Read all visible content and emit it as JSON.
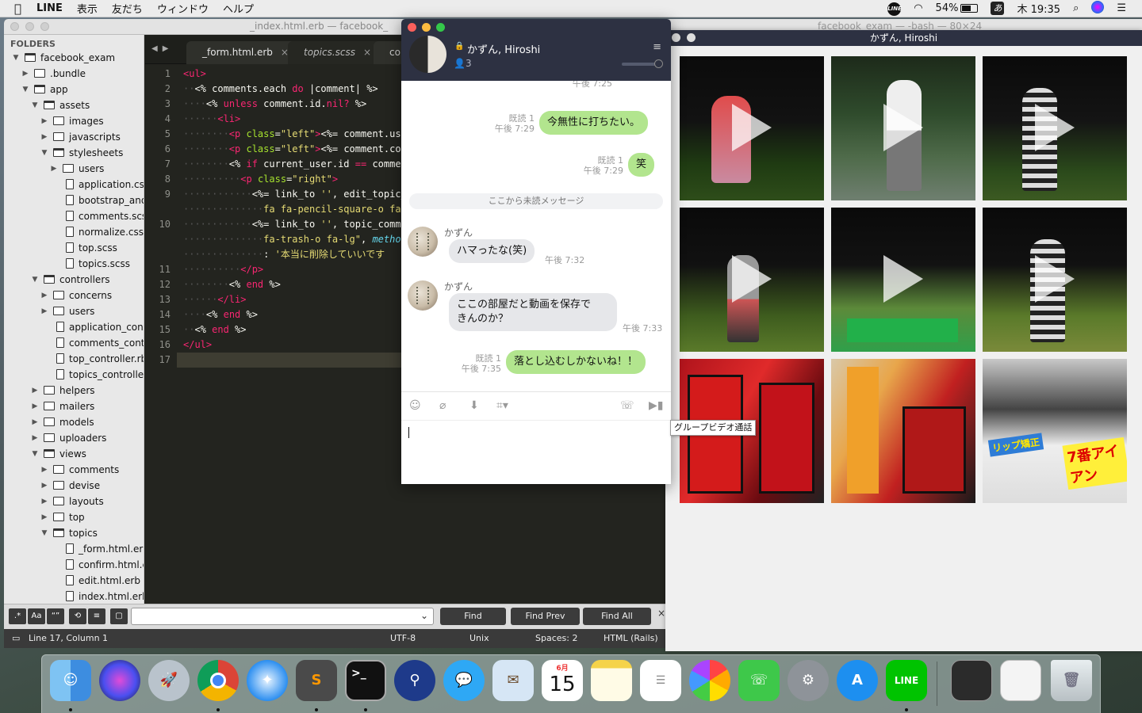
{
  "menubar": {
    "app": "LINE",
    "items": [
      "表示",
      "友だち",
      "ウィンドウ",
      "ヘルプ"
    ],
    "line_badge": "LINE",
    "battery": "54%",
    "ime": "あ",
    "clock": "木 19:35"
  },
  "sublime": {
    "title": "_index.html.erb — facebook_",
    "folders_header": "FOLDERS",
    "tree": [
      {
        "label": "facebook_exam",
        "depth": 0,
        "type": "folder",
        "open": true
      },
      {
        "label": ".bundle",
        "depth": 1,
        "type": "folder",
        "open": false
      },
      {
        "label": "app",
        "depth": 1,
        "type": "folder",
        "open": true
      },
      {
        "label": "assets",
        "depth": 2,
        "type": "folder",
        "open": true
      },
      {
        "label": "images",
        "depth": 3,
        "type": "folder",
        "open": false
      },
      {
        "label": "javascripts",
        "depth": 3,
        "type": "folder",
        "open": false
      },
      {
        "label": "stylesheets",
        "depth": 3,
        "type": "folder",
        "open": true
      },
      {
        "label": "users",
        "depth": 4,
        "type": "folder",
        "open": false
      },
      {
        "label": "application.css",
        "depth": 4,
        "type": "file"
      },
      {
        "label": "bootstrap_and_",
        "depth": 4,
        "type": "file"
      },
      {
        "label": "comments.scss",
        "depth": 4,
        "type": "file"
      },
      {
        "label": "normalize.css",
        "depth": 4,
        "type": "file"
      },
      {
        "label": "top.scss",
        "depth": 4,
        "type": "file"
      },
      {
        "label": "topics.scss",
        "depth": 4,
        "type": "file"
      },
      {
        "label": "controllers",
        "depth": 2,
        "type": "folder",
        "open": true
      },
      {
        "label": "concerns",
        "depth": 3,
        "type": "folder",
        "open": false
      },
      {
        "label": "users",
        "depth": 3,
        "type": "folder",
        "open": false
      },
      {
        "label": "application_contro",
        "depth": 3,
        "type": "file"
      },
      {
        "label": "comments_contro",
        "depth": 3,
        "type": "file"
      },
      {
        "label": "top_controller.rb",
        "depth": 3,
        "type": "file"
      },
      {
        "label": "topics_controller.r",
        "depth": 3,
        "type": "file"
      },
      {
        "label": "helpers",
        "depth": 2,
        "type": "folder",
        "open": false
      },
      {
        "label": "mailers",
        "depth": 2,
        "type": "folder",
        "open": false
      },
      {
        "label": "models",
        "depth": 2,
        "type": "folder",
        "open": false
      },
      {
        "label": "uploaders",
        "depth": 2,
        "type": "folder",
        "open": false
      },
      {
        "label": "views",
        "depth": 2,
        "type": "folder",
        "open": true
      },
      {
        "label": "comments",
        "depth": 3,
        "type": "folder",
        "open": false
      },
      {
        "label": "devise",
        "depth": 3,
        "type": "folder",
        "open": false
      },
      {
        "label": "layouts",
        "depth": 3,
        "type": "folder",
        "open": false
      },
      {
        "label": "top",
        "depth": 3,
        "type": "folder",
        "open": false
      },
      {
        "label": "topics",
        "depth": 3,
        "type": "folder",
        "open": true
      },
      {
        "label": "_form.html.erb",
        "depth": 4,
        "type": "file"
      },
      {
        "label": "confirm.html.er",
        "depth": 4,
        "type": "file"
      },
      {
        "label": "edit.html.erb",
        "depth": 4,
        "type": "file"
      },
      {
        "label": "index.html.erb",
        "depth": 4,
        "type": "file"
      }
    ],
    "tabs": [
      {
        "label": "_form.html.erb",
        "close": "×"
      },
      {
        "label": "topics.scss",
        "close": "×"
      },
      {
        "label": "con",
        "close": ""
      }
    ],
    "line_numbers": [
      "1",
      "2",
      "3",
      "4",
      "5",
      "6",
      "7",
      "8",
      "9",
      "",
      "10",
      "",
      "",
      "11",
      "12",
      "13",
      "14",
      "15",
      "16",
      "17"
    ],
    "code": [
      [
        [
          "tag",
          "<ul>"
        ]
      ],
      [
        [
          "dots",
          "··"
        ],
        [
          "erb",
          "<% comments.each "
        ],
        [
          "kw",
          "do"
        ],
        [
          "erb",
          " |comment| %>"
        ]
      ],
      [
        [
          "dots",
          "····"
        ],
        [
          "erb",
          "<% "
        ],
        [
          "kw",
          "unless"
        ],
        [
          "erb",
          " comment.id."
        ],
        [
          "kw",
          "nil?"
        ],
        [
          "erb",
          " %>"
        ]
      ],
      [
        [
          "dots",
          "······"
        ],
        [
          "tag",
          "<li>"
        ]
      ],
      [
        [
          "dots",
          "········"
        ],
        [
          "tag",
          "<p "
        ],
        [
          "attr",
          "class"
        ],
        [
          "erb",
          "="
        ],
        [
          "str",
          "\"left\""
        ],
        [
          "tag",
          ">"
        ],
        [
          "erb",
          "<%= comment.use"
        ]
      ],
      [
        [
          "dots",
          "········"
        ],
        [
          "tag",
          "<p "
        ],
        [
          "attr",
          "class"
        ],
        [
          "erb",
          "="
        ],
        [
          "str",
          "\"left\""
        ],
        [
          "tag",
          ">"
        ],
        [
          "erb",
          "<%= comment.con"
        ]
      ],
      [
        [
          "dots",
          "········"
        ],
        [
          "erb",
          "<% "
        ],
        [
          "kw",
          "if"
        ],
        [
          "erb",
          " current_user.id "
        ],
        [
          "kw",
          "=="
        ],
        [
          "erb",
          " commen"
        ]
      ],
      [
        [
          "dots",
          "··········"
        ],
        [
          "tag",
          "<p "
        ],
        [
          "attr",
          "class"
        ],
        [
          "erb",
          "="
        ],
        [
          "str",
          "\"right\""
        ],
        [
          "tag",
          ">"
        ]
      ],
      [
        [
          "dots",
          "············"
        ],
        [
          "erb",
          "<%= link_to "
        ],
        [
          "str",
          "''"
        ],
        [
          "erb",
          ", edit_topic_"
        ]
      ],
      [
        [
          "dots",
          "··············"
        ],
        [
          "str",
          "fa fa-pencil-square-o fa-"
        ]
      ],
      [
        [
          "dots",
          "············"
        ],
        [
          "erb",
          "<%= link_to "
        ],
        [
          "str",
          "''"
        ],
        [
          "erb",
          ", topic_comme"
        ]
      ],
      [
        [
          "dots",
          "··············"
        ],
        [
          "str",
          "fa-trash-o fa-lg\""
        ],
        [
          "erb",
          ", "
        ],
        [
          "fn",
          "method"
        ]
      ],
      [
        [
          "dots",
          "··············"
        ],
        [
          "erb",
          ": "
        ],
        [
          "str",
          "'本当に削除していいです"
        ]
      ],
      [
        [
          "dots",
          "··········"
        ],
        [
          "tag",
          "</p>"
        ]
      ],
      [
        [
          "dots",
          "········"
        ],
        [
          "erb",
          "<% "
        ],
        [
          "kw",
          "end"
        ],
        [
          "erb",
          " %>"
        ]
      ],
      [
        [
          "dots",
          "······"
        ],
        [
          "tag",
          "</li>"
        ]
      ],
      [
        [
          "dots",
          "····"
        ],
        [
          "erb",
          "<% "
        ],
        [
          "kw",
          "end"
        ],
        [
          "erb",
          " %>"
        ]
      ],
      [
        [
          "dots",
          "··"
        ],
        [
          "erb",
          "<% "
        ],
        [
          "kw",
          "end"
        ],
        [
          "erb",
          " %>"
        ]
      ],
      [
        [
          "tag",
          "</ul>"
        ]
      ],
      []
    ],
    "find": {
      "toggles": [
        ".*",
        "Aa",
        "“”"
      ],
      "find": "Find",
      "find_prev": "Find Prev",
      "find_all": "Find All",
      "close": "×"
    },
    "status": {
      "position": "Line 17, Column 1",
      "encoding": "UTF-8",
      "line_endings": "Unix",
      "indent": "Spaces: 2",
      "syntax": "HTML (Rails)"
    }
  },
  "terminal": {
    "title": "facebook_exam — -bash — 80×24"
  },
  "photos": {
    "title": "かずん, Hiroshi",
    "signs": [
      "7番アイアン",
      "リップ矯正"
    ]
  },
  "chat": {
    "group_name": "かずん, Hiroshi",
    "member_count": "3",
    "menu_icon": "≡",
    "prev_time": "午後 7:25",
    "messages": [
      {
        "from": "me",
        "text": "今無性に打ちたい。",
        "read": "既読 1",
        "time": "午後 7:29"
      },
      {
        "from": "me",
        "text": "笑",
        "read": "既読 1",
        "time": "午後 7:29"
      },
      {
        "from": "them",
        "sender": "かずん",
        "text": "ハマったな(笑)",
        "time": "午後 7:32"
      },
      {
        "from": "them",
        "sender": "かずん",
        "text": "ここの部屋だと動画を保存で\nきんのか？",
        "time": "午後 7:33"
      },
      {
        "from": "me",
        "text": "落とし込むしかないね！！",
        "read": "既読 1",
        "time": "午後 7:35"
      }
    ],
    "unread_divider": "ここから未読メッセージ",
    "tooltip": "グループビデオ通話"
  },
  "colors": {
    "line_green": "#00c300",
    "bubble_me": "#b2e58e",
    "chat_header": "#2d3142",
    "editor_bg": "#23241f"
  },
  "dock": {
    "items": [
      "finder",
      "siri",
      "launchpad",
      "chrome",
      "safari",
      "sublime-text",
      "terminal",
      "sourcetree",
      "messages",
      "mail",
      "calendar",
      "notes",
      "reminders",
      "photos",
      "facetime",
      "system-preferences",
      "app-store",
      "line",
      "screenshot-preview",
      "doc-preview",
      "trash"
    ],
    "calendar_month": "6月",
    "calendar_day": "15",
    "line_label": "LINE"
  }
}
